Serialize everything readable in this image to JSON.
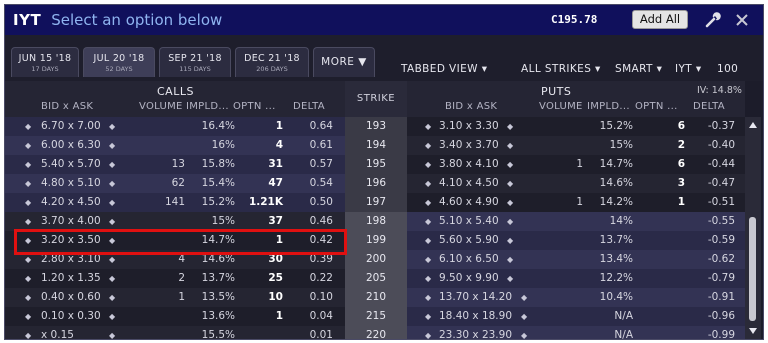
{
  "title": {
    "symbol": "IYT",
    "prompt": "Select an option below",
    "price": "C195.78",
    "add_all": "Add All"
  },
  "tabs": [
    {
      "date": "JUN 15 '18",
      "days": "17 DAYS"
    },
    {
      "date": "JUL 20 '18",
      "days": "52 DAYS"
    },
    {
      "date": "SEP 21 '18",
      "days": "115 DAYS"
    },
    {
      "date": "DEC 21 '18",
      "days": "206 DAYS"
    }
  ],
  "more_label": "MORE",
  "controls": {
    "view": "TABBED VIEW",
    "strikes": "ALL STRIKES",
    "exchange": "SMART",
    "underlying": "IYT",
    "quantity": "100",
    "iv": "IV: 14.8%"
  },
  "headers": {
    "calls_title": "CALLS",
    "puts_title": "PUTS",
    "strike": "STRIKE",
    "bid_ask": "BID x ASK",
    "volume": "VOLUME",
    "impld": "IMPLD...",
    "optn": "OPTN ...",
    "delta": "DELTA"
  },
  "rows": [
    {
      "strike": "193",
      "c_bidask": "6.70 x 7.00",
      "c_vol": "",
      "c_impl": "16.4%",
      "c_oi": "1",
      "c_delta": "0.64",
      "p_bidask": "3.10 x 3.30",
      "p_vol": "",
      "p_impl": "15.2%",
      "p_oi": "6",
      "p_delta": "-0.37"
    },
    {
      "strike": "194",
      "c_bidask": "6.00 x 6.30",
      "c_vol": "",
      "c_impl": "16%",
      "c_oi": "4",
      "c_delta": "0.61",
      "p_bidask": "3.40 x 3.70",
      "p_vol": "",
      "p_impl": "15%",
      "p_oi": "2",
      "p_delta": "-0.40"
    },
    {
      "strike": "195",
      "c_bidask": "5.40 x 5.70",
      "c_vol": "13",
      "c_impl": "15.8%",
      "c_oi": "31",
      "c_delta": "0.57",
      "p_bidask": "3.80 x 4.10",
      "p_vol": "1",
      "p_impl": "14.7%",
      "p_oi": "6",
      "p_delta": "-0.44"
    },
    {
      "strike": "196",
      "c_bidask": "4.80 x 5.10",
      "c_vol": "62",
      "c_impl": "15.4%",
      "c_oi": "47",
      "c_delta": "0.54",
      "p_bidask": "4.10 x 4.50",
      "p_vol": "",
      "p_impl": "14.6%",
      "p_oi": "3",
      "p_delta": "-0.47"
    },
    {
      "strike": "197",
      "c_bidask": "4.20 x 4.50",
      "c_vol": "141",
      "c_impl": "15.2%",
      "c_oi": "1.21K",
      "c_delta": "0.50",
      "p_bidask": "4.60 x 4.90",
      "p_vol": "1",
      "p_impl": "14.2%",
      "p_oi": "1",
      "p_delta": "-0.51"
    },
    {
      "strike": "198",
      "c_bidask": "3.70 x 4.00",
      "c_vol": "",
      "c_impl": "15%",
      "c_oi": "37",
      "c_delta": "0.46",
      "p_bidask": "5.10 x 5.40",
      "p_vol": "",
      "p_impl": "14%",
      "p_oi": "",
      "p_delta": "-0.55"
    },
    {
      "strike": "199",
      "c_bidask": "3.20 x 3.50",
      "c_vol": "",
      "c_impl": "14.7%",
      "c_oi": "1",
      "c_delta": "0.42",
      "p_bidask": "5.60 x 5.90",
      "p_vol": "",
      "p_impl": "13.7%",
      "p_oi": "",
      "p_delta": "-0.59"
    },
    {
      "strike": "200",
      "c_bidask": "2.80 x 3.10",
      "c_vol": "4",
      "c_impl": "14.6%",
      "c_oi": "30",
      "c_delta": "0.39",
      "p_bidask": "6.10 x 6.50",
      "p_vol": "",
      "p_impl": "13.4%",
      "p_oi": "",
      "p_delta": "-0.62"
    },
    {
      "strike": "205",
      "c_bidask": "1.20 x 1.35",
      "c_vol": "2",
      "c_impl": "13.7%",
      "c_oi": "25",
      "c_delta": "0.22",
      "p_bidask": "9.50 x 9.90",
      "p_vol": "",
      "p_impl": "12.2%",
      "p_oi": "",
      "p_delta": "-0.79"
    },
    {
      "strike": "210",
      "c_bidask": "0.40 x 0.60",
      "c_vol": "1",
      "c_impl": "13.5%",
      "c_oi": "10",
      "c_delta": "0.10",
      "p_bidask": "13.70 x 14.20",
      "p_vol": "",
      "p_impl": "10.4%",
      "p_oi": "",
      "p_delta": "-0.91"
    },
    {
      "strike": "215",
      "c_bidask": "0.10 x 0.30",
      "c_vol": "",
      "c_impl": "13.6%",
      "c_oi": "1",
      "c_delta": "0.04",
      "p_bidask": "18.40 x 18.90",
      "p_vol": "",
      "p_impl": "N/A",
      "p_oi": "",
      "p_delta": "-0.96"
    },
    {
      "strike": "220",
      "c_bidask": "x 0.15",
      "c_vol": "",
      "c_impl": "15.5%",
      "c_oi": "",
      "c_delta": "0.01",
      "p_bidask": "23.30 x 23.90",
      "p_vol": "",
      "p_impl": "N/A",
      "p_oi": "",
      "p_delta": "-0.99"
    }
  ],
  "colors": {
    "title_bg": "#10105c",
    "highlight": "#e01010",
    "itm_bg": "#2a2a48"
  }
}
